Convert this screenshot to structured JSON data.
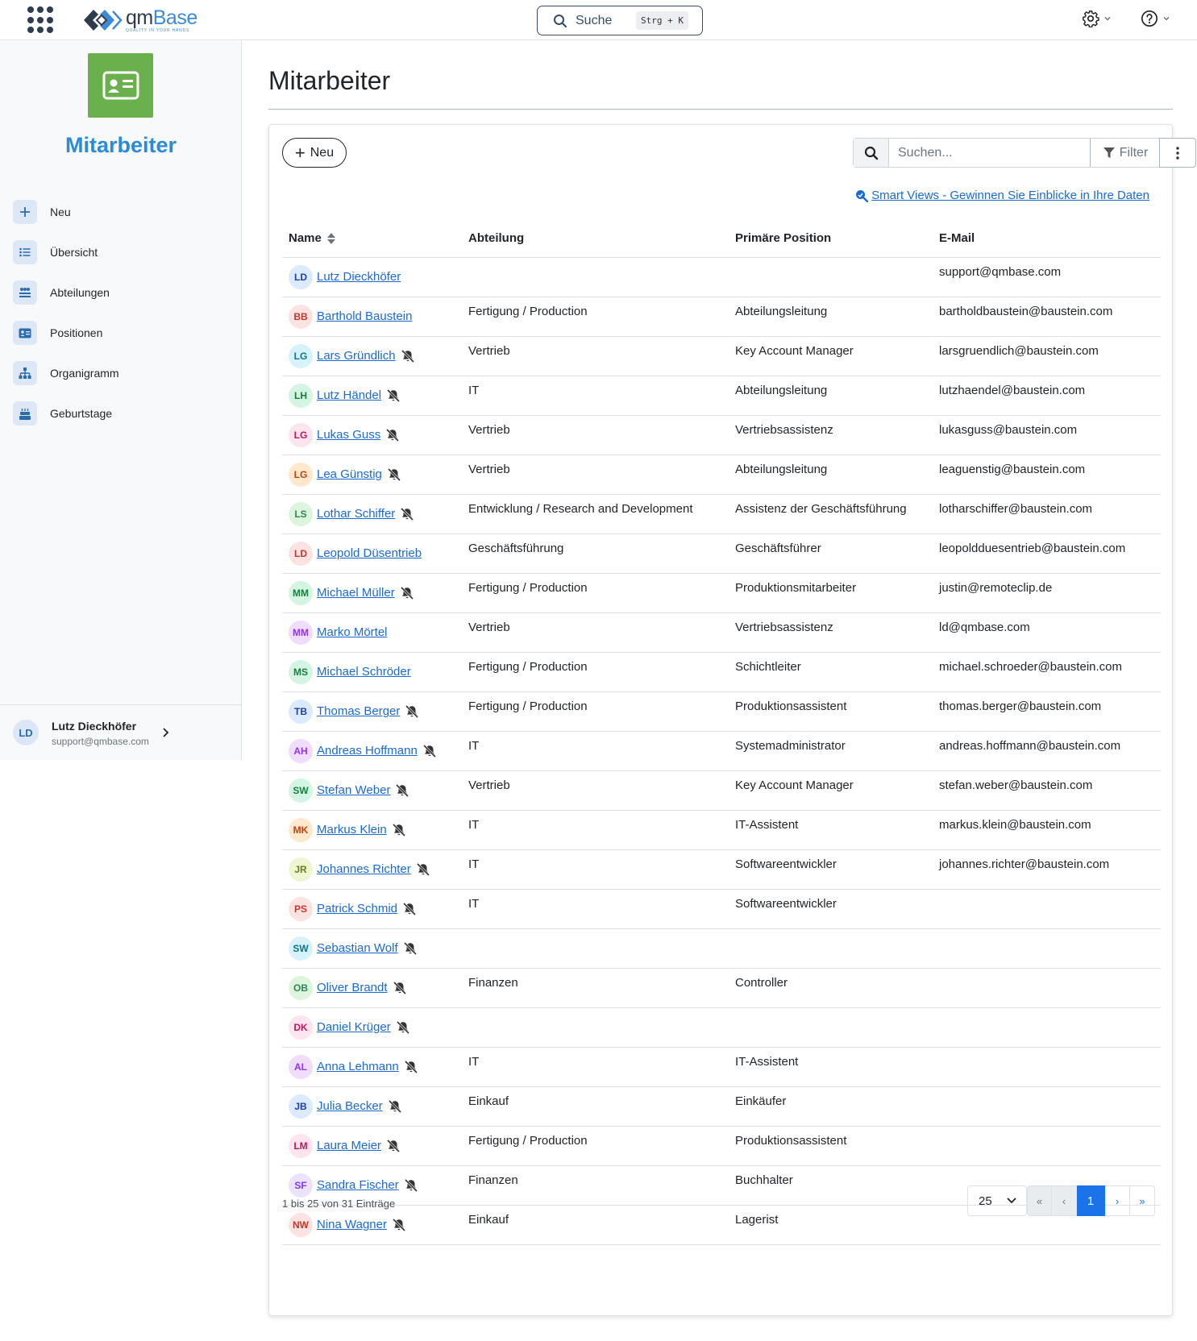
{
  "topbar": {
    "logo_word_a": "qm",
    "logo_word_b": "Base",
    "logo_tagline": "QUALITY IN YOUR HANDS",
    "search_label": "Suche",
    "search_shortcut": "Strg + K"
  },
  "sidebar": {
    "module_title": "Mitarbeiter",
    "items": [
      {
        "label": "Neu",
        "icon": "plus-icon"
      },
      {
        "label": "Übersicht",
        "icon": "list-icon"
      },
      {
        "label": "Abteilungen",
        "icon": "departments-icon"
      },
      {
        "label": "Positionen",
        "icon": "positions-icon"
      },
      {
        "label": "Organigramm",
        "icon": "org-chart-icon"
      },
      {
        "label": "Geburtstage",
        "icon": "birthday-cake-icon"
      }
    ],
    "user": {
      "initials": "LD",
      "name": "Lutz Dieckhöfer",
      "email": "support@qmbase.com"
    }
  },
  "main": {
    "title": "Mitarbeiter",
    "new_button": "Neu",
    "search_placeholder": "Suchen...",
    "filter_label": "Filter",
    "smart_views_link": " Smart Views - Gewinnen Sie Einblicke in Ihre Daten",
    "columns": [
      "Name",
      "Abteilung",
      "Primäre Position",
      "E-Mail"
    ],
    "rows": [
      {
        "initials": "LD",
        "color": "#dbeafe",
        "fg": "#1e40af",
        "name": "Lutz Dieckhöfer",
        "muted": false,
        "dept": "",
        "pos": "",
        "email": "support@qmbase.com"
      },
      {
        "initials": "BB",
        "color": "#fde2e2",
        "fg": "#c0392b",
        "name": "Barthold Baustein",
        "muted": false,
        "dept": "Fertigung / Production",
        "pos": "Abteilungsleitung",
        "email": "bartholdbaustein@baustein.com"
      },
      {
        "initials": "LG",
        "color": "#d6f3fb",
        "fg": "#0e7490",
        "name": "Lars Gründlich",
        "muted": true,
        "dept": "Vertrieb",
        "pos": "Key Account Manager",
        "email": "larsgruendlich@baustein.com"
      },
      {
        "initials": "LH",
        "color": "#d4f5e3",
        "fg": "#15803d",
        "name": "Lutz Händel",
        "muted": true,
        "dept": "IT",
        "pos": "Abteilungsleitung",
        "email": "lutzhaendel@baustein.com"
      },
      {
        "initials": "LG",
        "color": "#fde4ef",
        "fg": "#be185d",
        "name": "Lukas Guss",
        "muted": true,
        "dept": "Vertrieb",
        "pos": "Vertriebsassistenz",
        "email": "lukasguss@baustein.com"
      },
      {
        "initials": "LG",
        "color": "#ffe8cc",
        "fg": "#c2410c",
        "name": "Lea Günstig",
        "muted": true,
        "dept": "Vertrieb",
        "pos": "Abteilungsleitung",
        "email": "leaguenstig@baustein.com"
      },
      {
        "initials": "LS",
        "color": "#dcf5dc",
        "fg": "#2f855a",
        "name": "Lothar Schiffer",
        "muted": true,
        "dept": "Entwicklung / Research and Development",
        "pos": "Assistenz der Geschäftsführung",
        "email": "lotharschiffer@baustein.com"
      },
      {
        "initials": "LD",
        "color": "#fde2e2",
        "fg": "#c0392b",
        "name": "Leopold Düsentrieb",
        "muted": false,
        "dept": "Geschäftsführung",
        "pos": "Geschäftsführer",
        "email": "leopoldduesentrieb@baustein.com"
      },
      {
        "initials": "MM",
        "color": "#d4f5e3",
        "fg": "#15803d",
        "name": "Michael Müller",
        "muted": true,
        "dept": "Fertigung / Production",
        "pos": "Produktionsmitarbeiter",
        "email": "justin@remoteclip.de"
      },
      {
        "initials": "MM",
        "color": "#f0dcfb",
        "fg": "#9333ea",
        "name": "Marko Mörtel",
        "muted": false,
        "dept": "Vertrieb",
        "pos": "Vertriebsassistenz",
        "email": "ld@qmbase.com"
      },
      {
        "initials": "MS",
        "color": "#d4f5e3",
        "fg": "#15803d",
        "name": "Michael Schröder",
        "muted": false,
        "dept": "Fertigung / Production",
        "pos": "Schichtleiter",
        "email": "michael.schroeder@baustein.com"
      },
      {
        "initials": "TB",
        "color": "#dbeafe",
        "fg": "#1e40af",
        "name": "Thomas Berger",
        "muted": true,
        "dept": "Fertigung / Production",
        "pos": "Produktionsassistent",
        "email": "thomas.berger@baustein.com"
      },
      {
        "initials": "AH",
        "color": "#f0dcfb",
        "fg": "#9333ea",
        "name": "Andreas Hoffmann",
        "muted": true,
        "dept": "IT",
        "pos": "Systemadministrator",
        "email": "andreas.hoffmann@baustein.com"
      },
      {
        "initials": "SW",
        "color": "#d4f5e3",
        "fg": "#15803d",
        "name": "Stefan Weber",
        "muted": true,
        "dept": "Vertrieb",
        "pos": "Key Account Manager",
        "email": "stefan.weber@baustein.com"
      },
      {
        "initials": "MK",
        "color": "#ffe8cc",
        "fg": "#c2410c",
        "name": "Markus Klein",
        "muted": true,
        "dept": "IT",
        "pos": "IT-Assistent",
        "email": "markus.klein@baustein.com"
      },
      {
        "initials": "JR",
        "color": "#eef6d2",
        "fg": "#65801c",
        "name": "Johannes Richter",
        "muted": true,
        "dept": "IT",
        "pos": "Softwareentwickler",
        "email": "johannes.richter@baustein.com"
      },
      {
        "initials": "PS",
        "color": "#fde2e2",
        "fg": "#c0392b",
        "name": "Patrick Schmid",
        "muted": true,
        "dept": "IT",
        "pos": "Softwareentwickler",
        "email": ""
      },
      {
        "initials": "SW",
        "color": "#d6f3fb",
        "fg": "#0e7490",
        "name": "Sebastian Wolf",
        "muted": true,
        "dept": "",
        "pos": "",
        "email": ""
      },
      {
        "initials": "OB",
        "color": "#dcf5dc",
        "fg": "#2f855a",
        "name": "Oliver Brandt",
        "muted": true,
        "dept": "Finanzen",
        "pos": "Controller",
        "email": ""
      },
      {
        "initials": "DK",
        "color": "#fde4ef",
        "fg": "#be185d",
        "name": "Daniel Krüger",
        "muted": true,
        "dept": "",
        "pos": "",
        "email": ""
      },
      {
        "initials": "AL",
        "color": "#f0dcfb",
        "fg": "#9333ea",
        "name": "Anna Lehmann",
        "muted": true,
        "dept": "IT",
        "pos": "IT-Assistent",
        "email": ""
      },
      {
        "initials": "JB",
        "color": "#dbeafe",
        "fg": "#1e40af",
        "name": "Julia Becker",
        "muted": true,
        "dept": "Einkauf",
        "pos": "Einkäufer",
        "email": ""
      },
      {
        "initials": "LM",
        "color": "#fde4ef",
        "fg": "#be185d",
        "name": "Laura Meier",
        "muted": true,
        "dept": "Fertigung / Production",
        "pos": "Produktionsassistent",
        "email": ""
      },
      {
        "initials": "SF",
        "color": "#ece2fb",
        "fg": "#7c3aed",
        "name": "Sandra Fischer",
        "muted": true,
        "dept": "Finanzen",
        "pos": "Buchhalter",
        "email": ""
      },
      {
        "initials": "NW",
        "color": "#fde2e2",
        "fg": "#c0392b",
        "name": "Nina Wagner",
        "muted": true,
        "dept": "Einkauf",
        "pos": "Lagerist",
        "email": ""
      }
    ],
    "footer_info": "1 bis 25 von 31 Einträge",
    "page_size": "25",
    "pager": {
      "first": "«",
      "prev": "‹",
      "current": "1",
      "next": "›",
      "last": "»"
    }
  },
  "colors": {
    "accent": "#2b8bd6",
    "module_green": "#6ab04c",
    "link": "#1a6bd1",
    "active_page": "#1a73e8"
  }
}
